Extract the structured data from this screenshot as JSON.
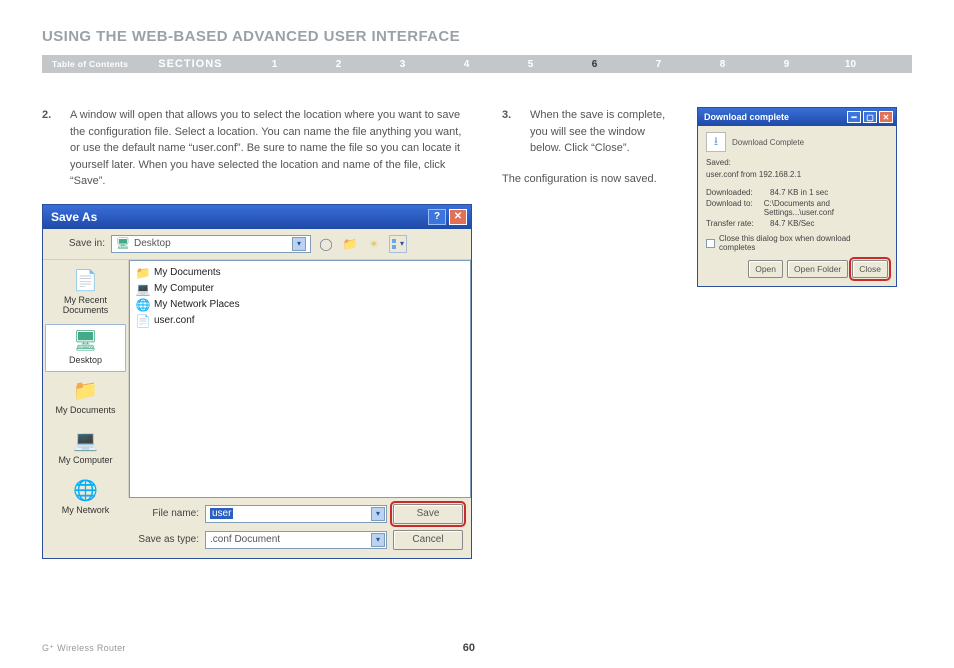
{
  "heading": "USING THE WEB-BASED ADVANCED USER INTERFACE",
  "nav": {
    "toc": "Table of Contents",
    "sections_label": "SECTIONS",
    "numbers": [
      "1",
      "2",
      "3",
      "4",
      "5",
      "6",
      "7",
      "8",
      "9",
      "10"
    ],
    "current_index": 5
  },
  "steps": {
    "s2": {
      "num": "2.",
      "text": "A window will open that allows you to select the location where you want to save the configuration file. Select a location. You can name the file anything you want, or use the default name “user.conf”. Be sure to name the file so you can locate it yourself later. When you have selected the location and name of the file, click “Save”."
    },
    "s3": {
      "num": "3.",
      "text": "When the save is complete, you will see the window below. Click “Close”."
    }
  },
  "note_after_s3": "The configuration is now saved.",
  "saveas": {
    "title": "Save As",
    "savein_label": "Save in:",
    "savein_value": "Desktop",
    "places": [
      {
        "label": "My Recent\nDocuments",
        "icon": "recent"
      },
      {
        "label": "Desktop",
        "icon": "desktop",
        "selected": true
      },
      {
        "label": "My Documents",
        "icon": "folder"
      },
      {
        "label": "My Computer",
        "icon": "computer"
      },
      {
        "label": "My Network",
        "icon": "network"
      }
    ],
    "files": [
      {
        "label": "My Documents",
        "icon": "folder"
      },
      {
        "label": "My Computer",
        "icon": "computer"
      },
      {
        "label": "My Network Places",
        "icon": "network"
      },
      {
        "label": "user.conf",
        "icon": "file"
      }
    ],
    "filename_label": "File name:",
    "filename_value": "user",
    "saveastype_label": "Save as type:",
    "saveastype_value": ".conf Document",
    "save_btn": "Save",
    "cancel_btn": "Cancel"
  },
  "dlc": {
    "title": "Download complete",
    "header": "Download Complete",
    "saved_label": "Saved:",
    "saved_value": "user.conf from 192.168.2.1",
    "rows": [
      {
        "k": "Downloaded:",
        "v": "84.7 KB in 1 sec"
      },
      {
        "k": "Download to:",
        "v": "C:\\Documents and Settings...\\user.conf"
      },
      {
        "k": "Transfer rate:",
        "v": "84.7 KB/Sec"
      }
    ],
    "checkbox": "Close this dialog box when download completes",
    "open_btn": "Open",
    "open_folder_btn": "Open Folder",
    "close_btn": "Close"
  },
  "footer": {
    "product": "G⁺ Wireless Router",
    "page": "60"
  }
}
